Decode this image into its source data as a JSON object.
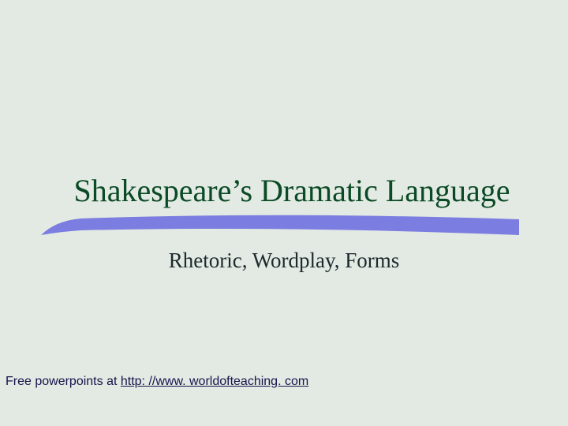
{
  "slide": {
    "title": "Shakespeare’s Dramatic Language",
    "subtitle": "Rhetoric, Wordplay, Forms",
    "footer_prefix": "Free powerpoints at ",
    "footer_link_text": "http: //www. worldofteaching. com",
    "swoosh_color": "#7b7ee0",
    "background_color": "#e3e9e3",
    "title_color": "#0a4a24"
  }
}
